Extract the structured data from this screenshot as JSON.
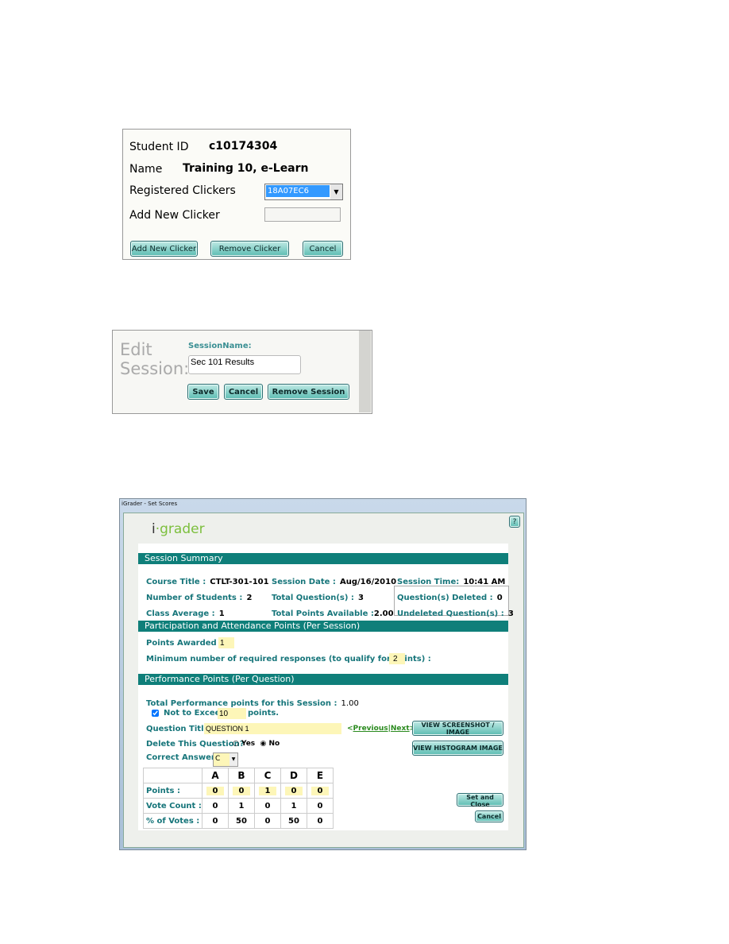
{
  "clicker_dialog": {
    "student_id_label": "Student ID",
    "student_id": "c10174304",
    "name_label": "Name",
    "name": "Training 10, e-Learn",
    "registered_label": "Registered Clickers",
    "registered_selected": "18A07EC6",
    "add_new_label": "Add New Clicker",
    "add_new_value": "",
    "buttons": {
      "add": "Add New Clicker",
      "remove": "Remove Clicker",
      "cancel": "Cancel"
    }
  },
  "edit_session": {
    "title_line1": "Edit",
    "title_line2": "Session:",
    "field_label": "SessionName:",
    "field_value": "Sec 101 Results",
    "buttons": {
      "save": "Save",
      "cancel": "Cancel",
      "remove": "Remove Session"
    }
  },
  "set_scores": {
    "window_title": "iGrader - Set Scores",
    "logo": "i·grader",
    "help": "?",
    "summary": {
      "header": "Session Summary",
      "course_title_label": "Course Title :",
      "course_title": "CTLT-301-101",
      "session_date_label": "Session Date :",
      "session_date": "Aug/16/2010",
      "session_time_label": "Session Time:",
      "session_time": "10:41 AM",
      "students_label": "Number of Students :",
      "students": "2",
      "total_q_label": "Total Question(s) :",
      "total_q": "3",
      "deleted_label": "Question(s) Deleted :",
      "deleted": "0",
      "avg_label": "Class Average :",
      "avg": "1",
      "points_avail_label": "Total Points Available :",
      "points_avail": "2.00",
      "undeleted_label": "Undeleted Question(s) :",
      "undeleted": "3"
    },
    "participation": {
      "header": "Participation and Attendance Points (Per Session)",
      "awarded_label": "Points Awarded :",
      "awarded": "1",
      "min_label": "Minimum number of required responses (to qualify for points) :",
      "min": "2"
    },
    "performance": {
      "header": "Performance Points (Per Question)",
      "total_label": "Total Performance points for this Session :",
      "total": "1.00",
      "not_exceed_label": "Not to Exceed",
      "not_exceed": "10",
      "points_suffix": "points.",
      "not_exceed_checked": true,
      "question_title_label": "Question Title :",
      "question_title": "QUESTION 1",
      "previous": "Previous",
      "next": "Next",
      "delete_label": "Delete This Question?",
      "yes": "Yes",
      "no": "No",
      "delete_selected": "No",
      "correct_label": "Correct Answer :",
      "correct": "C",
      "columns": [
        "A",
        "B",
        "C",
        "D",
        "E"
      ],
      "rows": [
        {
          "label": "Points :",
          "values": [
            "0",
            "0",
            "1",
            "0",
            "0"
          ]
        },
        {
          "label": "Vote Count :",
          "values": [
            "0",
            "1",
            "0",
            "1",
            "0"
          ]
        },
        {
          "label": "% of Votes  :",
          "values": [
            "0",
            "50",
            "0",
            "50",
            "0"
          ]
        }
      ],
      "buttons": {
        "screenshot": "VIEW SCREENSHOT / IMAGE",
        "histogram": "VIEW HISTOGRAM  IMAGE",
        "set_close": "Set and Close",
        "cancel": "Cancel"
      }
    }
  }
}
